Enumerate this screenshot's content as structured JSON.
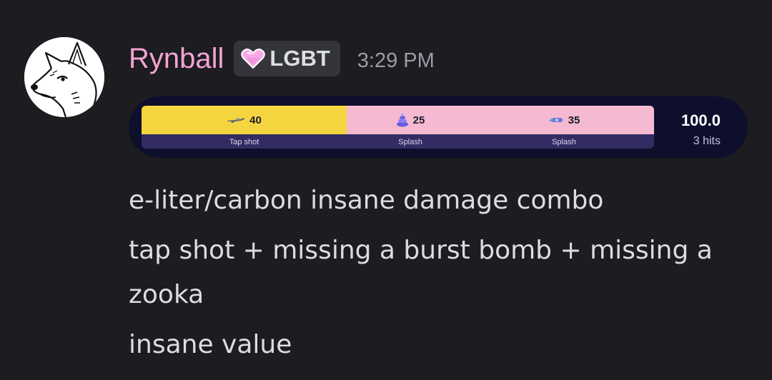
{
  "message": {
    "author": "Rynball",
    "author_color": "#f4a3d3",
    "role_tag": {
      "icon": "pink-heart-icon",
      "label": "LGBT"
    },
    "timestamp": "3:29 PM",
    "avatar": "white-fox-avatar"
  },
  "embed": {
    "segments": [
      {
        "icon": "rifle-icon",
        "value": "40",
        "label": "Tap shot",
        "color": "#f5d53f"
      },
      {
        "icon": "burst-bomb-icon",
        "value": "25",
        "label": "Splash",
        "color": "#f5b9d2"
      },
      {
        "icon": "zooka-icon",
        "value": "35",
        "label": "Splash",
        "color": "#f5b9d2"
      }
    ],
    "total": "100.0",
    "hits": "3 hits"
  },
  "content": {
    "line1": "e-liter/carbon insane damage combo",
    "line2": "tap shot + missing a burst bomb + missing a zooka",
    "line3": "insane value"
  }
}
